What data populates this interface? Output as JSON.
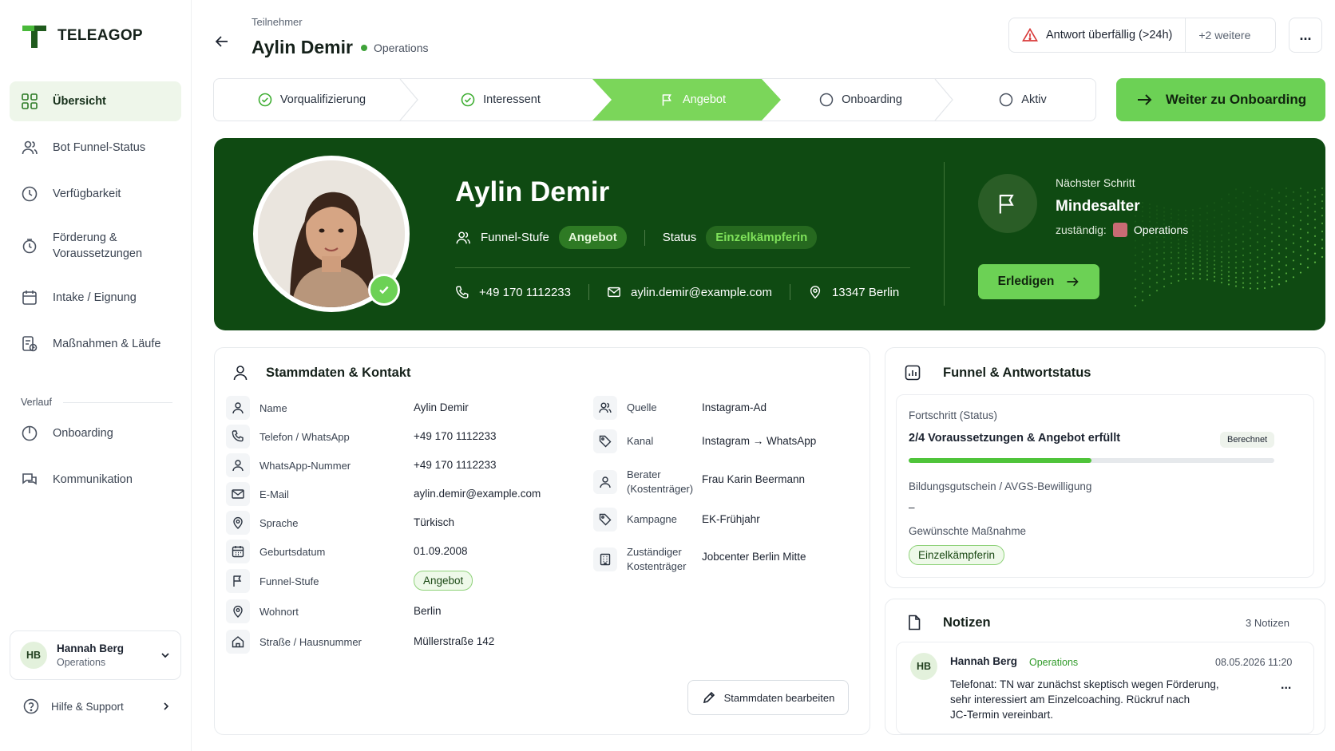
{
  "app": {
    "name": "TELEAGOP"
  },
  "sidebar": {
    "items": [
      {
        "label": "Übersicht"
      },
      {
        "label": "Bot Funnel-Status"
      },
      {
        "label": "Verfügbarkeit"
      },
      {
        "label": "Förderung & Voraussetzungen"
      },
      {
        "label": "Intake / Eignung"
      },
      {
        "label": "Maßnahmen & Läufe"
      }
    ],
    "section_label": "Verlauf",
    "section_items": [
      {
        "label": "Onboarding"
      },
      {
        "label": "Kommunikation"
      }
    ],
    "user": {
      "initials": "HB",
      "name": "Hannah Berg",
      "role": "Operations"
    },
    "help_label": "Hilfe & Support"
  },
  "header": {
    "breadcrumb": "Teilnehmer",
    "title": "Aylin Demir",
    "department": "Operations",
    "alert": "Antwort überfällig (>24h)",
    "alert_more": "+2 weitere",
    "more": "..."
  },
  "stepper": {
    "steps": [
      {
        "label": "Vorqualifizierung",
        "state": "done"
      },
      {
        "label": "Interessent",
        "state": "done"
      },
      {
        "label": "Angebot",
        "state": "active"
      },
      {
        "label": "Onboarding",
        "state": "todo"
      },
      {
        "label": "Aktiv",
        "state": "todo"
      }
    ],
    "next_label": "Weiter zu Onboarding"
  },
  "hero": {
    "name": "Aylin Demir",
    "funnel_label": "Funnel-Stufe",
    "funnel_value": "Angebot",
    "status_label": "Status",
    "status_value": "Einzelkämpferin",
    "phone": "+49 170 1112233",
    "email": "aylin.demir@example.com",
    "location": "13347 Berlin",
    "next_step_label": "Nächster Schritt",
    "next_step_value": "Mindesalter",
    "owner_label": "zuständig:",
    "owner_value": "Operations",
    "done_label": "Erledigen"
  },
  "stammdaten": {
    "title": "Stammdaten & Kontakt",
    "left": [
      {
        "label": "Name",
        "value": "Aylin Demir"
      },
      {
        "label": "Telefon / WhatsApp",
        "value": "+49 170 1112233"
      },
      {
        "label": "WhatsApp-Nummer",
        "value": "+49 170 1112233"
      },
      {
        "label": "E-Mail",
        "value": "aylin.demir@example.com"
      },
      {
        "label": "Sprache",
        "value": "Türkisch"
      },
      {
        "label": "Geburtsdatum",
        "value": "01.09.2008"
      },
      {
        "label": "Funnel-Stufe",
        "value": "Angebot"
      },
      {
        "label": "Wohnort",
        "value": "Berlin"
      },
      {
        "label": "Straße / Hausnummer",
        "value": "Müllerstraße 142"
      }
    ],
    "right": [
      {
        "label": "Quelle",
        "value": "Instagram-Ad"
      },
      {
        "label": "Kanal",
        "value": "Instagram → WhatsApp"
      },
      {
        "label": "Berater (Kostenträger)",
        "value": "Frau Karin Beermann"
      },
      {
        "label": "Kampagne",
        "value": "EK-Frühjahr"
      },
      {
        "label": "Zuständiger Kostenträger",
        "value": "Jobcenter Berlin Mitte"
      }
    ],
    "edit_label": "Stammdaten bearbeiten"
  },
  "funnel": {
    "title": "Funnel & Antwortstatus",
    "progress_label": "Fortschritt (Status)",
    "progress_value": "2/4 Voraussetzungen & Angebot erfüllt",
    "progress_badge": "Berechnet",
    "progress_fraction": 0.5,
    "voucher_label": "Bildungsgutschein / AVGS-Bewilligung",
    "voucher_value": "–",
    "measure_label": "Gewünschte Maßnahme",
    "measure_value": "Einzelkämpferin"
  },
  "notes": {
    "title": "Notizen",
    "count": "3 Notizen",
    "items": [
      {
        "initials": "HB",
        "author": "Hannah Berg",
        "role": "Operations",
        "date": "08.05.2026 11:20",
        "text_lines": [
          "Telefonat: TN war zunächst skeptisch wegen Förderung,",
          "sehr interessiert am Einzelcoaching. Rückruf nach",
          "JC-Termin vereinbart."
        ],
        "menu": "..."
      }
    ]
  },
  "colors": {
    "accent": "#6cd155",
    "hero_bg": "#0f4a12",
    "active_step": "#7bd65a"
  }
}
